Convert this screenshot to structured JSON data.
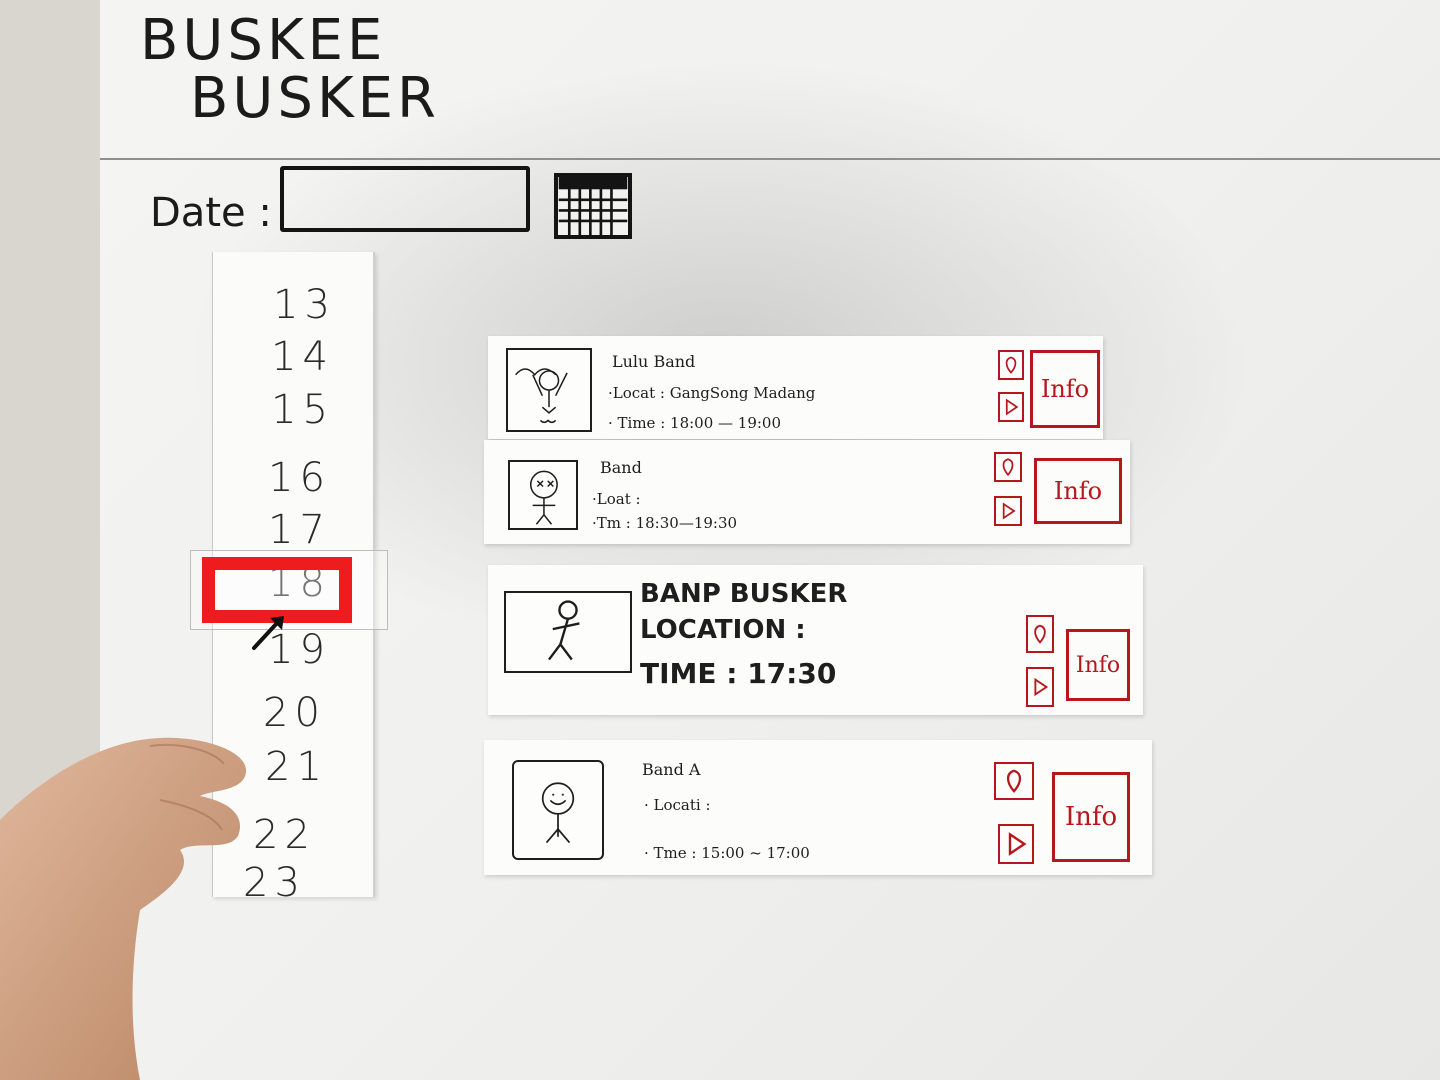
{
  "app": {
    "title_line1": "BUSKEE",
    "title_line2": "BUSKER"
  },
  "date_filter": {
    "label": "Date :",
    "value": "",
    "calendar_icon": "calendar-icon"
  },
  "hour_picker": {
    "hours": [
      "13",
      "14",
      "15",
      "16",
      "17",
      "18",
      "19",
      "20",
      "21",
      "22",
      "23"
    ],
    "selected": "18"
  },
  "buskers": [
    {
      "name": "Lulu Band",
      "location": "·Locat : GangSong Madang",
      "time": "· Time : 18:00 — 19:00",
      "info_label": "Info"
    },
    {
      "name": "Band",
      "location": "·Loat :",
      "time": "·Tm : 18:30—19:30",
      "info_label": "Info"
    },
    {
      "name": "BANP BUSKER",
      "location": "LOCATION :",
      "time": "TIME : 17:30",
      "info_label": "Info"
    },
    {
      "name": "Band A",
      "location": "· Locati :",
      "time": "· Tme : 15:00 ~ 17:00",
      "info_label": "Info"
    }
  ],
  "colors": {
    "ink": "#1e1e1e",
    "accent_red": "#b5171d",
    "selector_red": "#ee1c1c",
    "paper": "#f4f4f2"
  },
  "icons": {
    "map": "map-pin-icon",
    "play": "play-icon"
  }
}
